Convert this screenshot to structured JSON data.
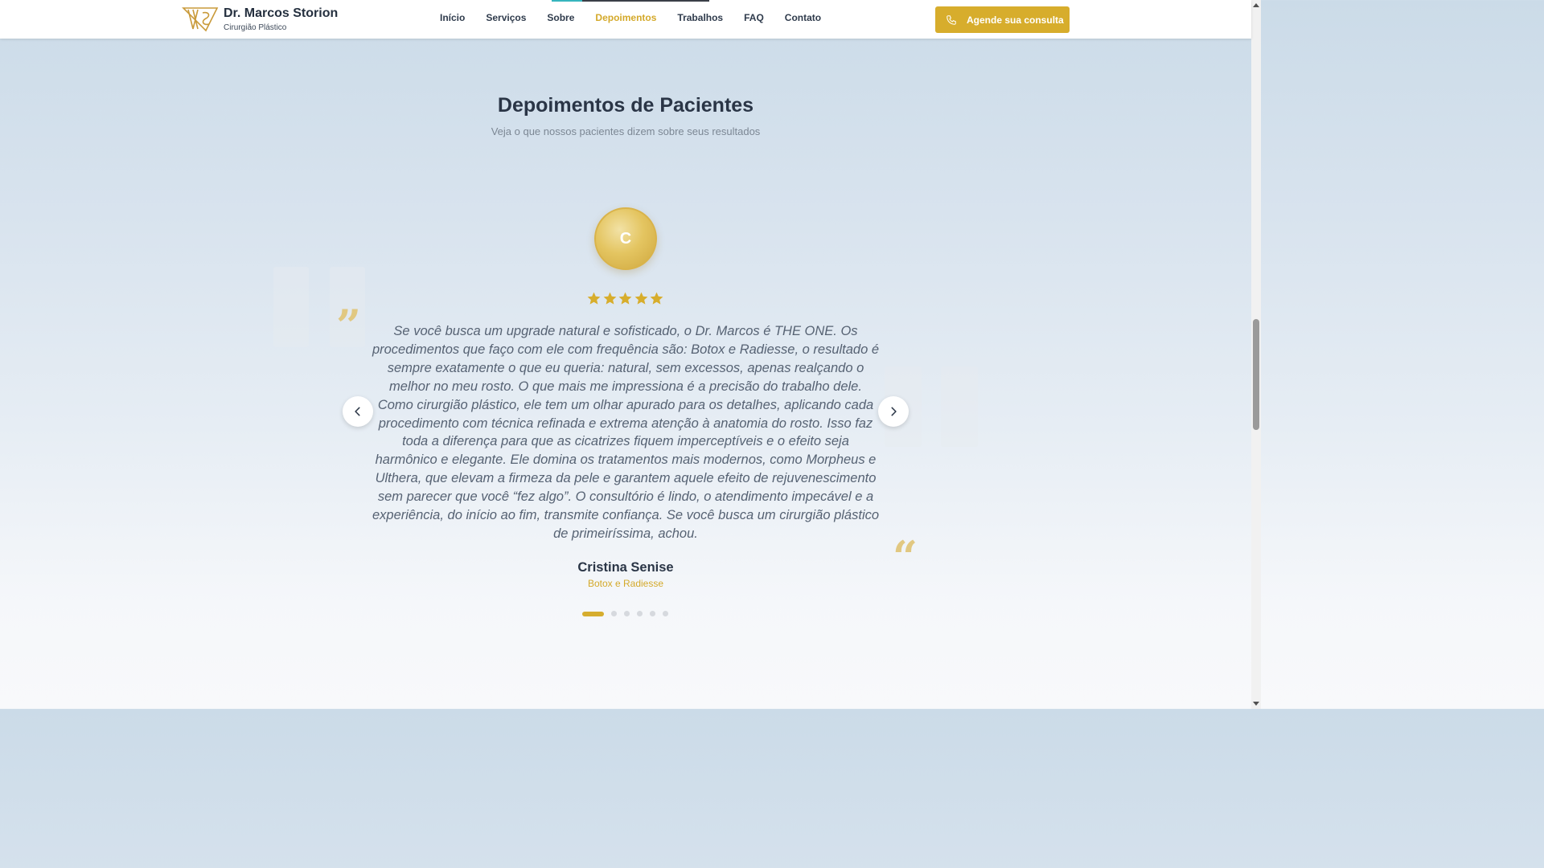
{
  "header": {
    "brand_name": "Dr. Marcos Storion",
    "brand_subtitle": "Cirurgião Plástico",
    "nav": [
      {
        "label": "Início",
        "active": false
      },
      {
        "label": "Serviços",
        "active": false
      },
      {
        "label": "Sobre",
        "active": false
      },
      {
        "label": "Depoimentos",
        "active": true
      },
      {
        "label": "Trabalhos",
        "active": false
      },
      {
        "label": "FAQ",
        "active": false
      },
      {
        "label": "Contato",
        "active": false
      }
    ],
    "cta_label": "Agende sua consulta",
    "cta_icon": "phone-icon"
  },
  "section": {
    "title": "Depoimentos de Pacientes",
    "subtitle": "Veja o que nossos pacientes dizem sobre seus resultados"
  },
  "testimonial": {
    "avatar_initial": "C",
    "rating": 5,
    "rating_max": 5,
    "text": "Se você busca um upgrade natural e sofisticado, o Dr. Marcos é THE ONE. Os procedimentos que faço com ele com frequência são: Botox e Radiesse, o resultado é sempre exatamente o que eu queria: natural, sem excessos, apenas realçando o melhor no meu rosto. O que mais me impressiona é a precisão do trabalho dele. Como cirurgião plástico, ele tem um olhar apurado para os detalhes, aplicando cada procedimento com técnica refinada e extrema atenção à anatomia do rosto. Isso faz toda a diferença para que as cicatrizes fiquem imperceptíveis e o efeito seja harmônico e elegante. Ele domina os tratamentos mais modernos, como Morpheus e Ulthera, que elevam a firmeza da pele e garantem aquele efeito de rejuvenescimento sem parecer que você “fez algo”. O consultório é lindo, o atendimento impecável e a experiência, do início ao fim, transmite confiança. Se você busca um cirurgião plástico de primeiríssima, achou.",
    "author": "Cristina Senise",
    "procedure": "Botox e Radiesse",
    "quote_open": "”",
    "quote_close": "“"
  },
  "carousel": {
    "slide_count": 6,
    "active_index": 0,
    "prev_icon": "chevron-left-icon",
    "next_icon": "chevron-right-icon"
  },
  "colors": {
    "accent_gold": "#d7ad2c",
    "heading": "#2a3546",
    "body_text": "#566273",
    "teal": "#36b5bd"
  }
}
